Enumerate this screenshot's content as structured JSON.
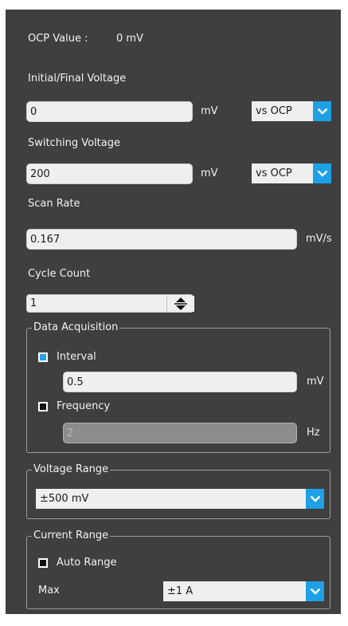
{
  "ocp": {
    "label": "OCP Value :",
    "value": "0 mV"
  },
  "initial_final": {
    "label": "Initial/Final Voltage",
    "value": "0",
    "unit": "mV",
    "ref": "vs OCP"
  },
  "switching": {
    "label": "Switching Voltage",
    "value": "200",
    "unit": "mV",
    "ref": "vs OCP"
  },
  "scan_rate": {
    "label": "Scan Rate",
    "value": "0.167",
    "unit": "mV/s"
  },
  "cycle_count": {
    "label": "Cycle Count",
    "value": "1"
  },
  "data_acquisition": {
    "title": "Data Acquisition",
    "interval": {
      "label": "Interval",
      "checked": true,
      "value": "0.5",
      "unit": "mV"
    },
    "frequency": {
      "label": "Frequency",
      "checked": false,
      "value": "2",
      "unit": "Hz"
    }
  },
  "voltage_range": {
    "title": "Voltage Range",
    "value": "±500 mV"
  },
  "current_range": {
    "title": "Current Range",
    "auto_range": {
      "label": "Auto Range",
      "checked": false
    },
    "max_label": "Max",
    "max_value": "±1 A"
  },
  "colors": {
    "panel": "#3f3f3f",
    "accent": "#1ea0e6",
    "field": "#efefef"
  },
  "icons": {
    "dropdown": "chevron-down-icon",
    "spinner": "up-down-spinner-icon"
  }
}
